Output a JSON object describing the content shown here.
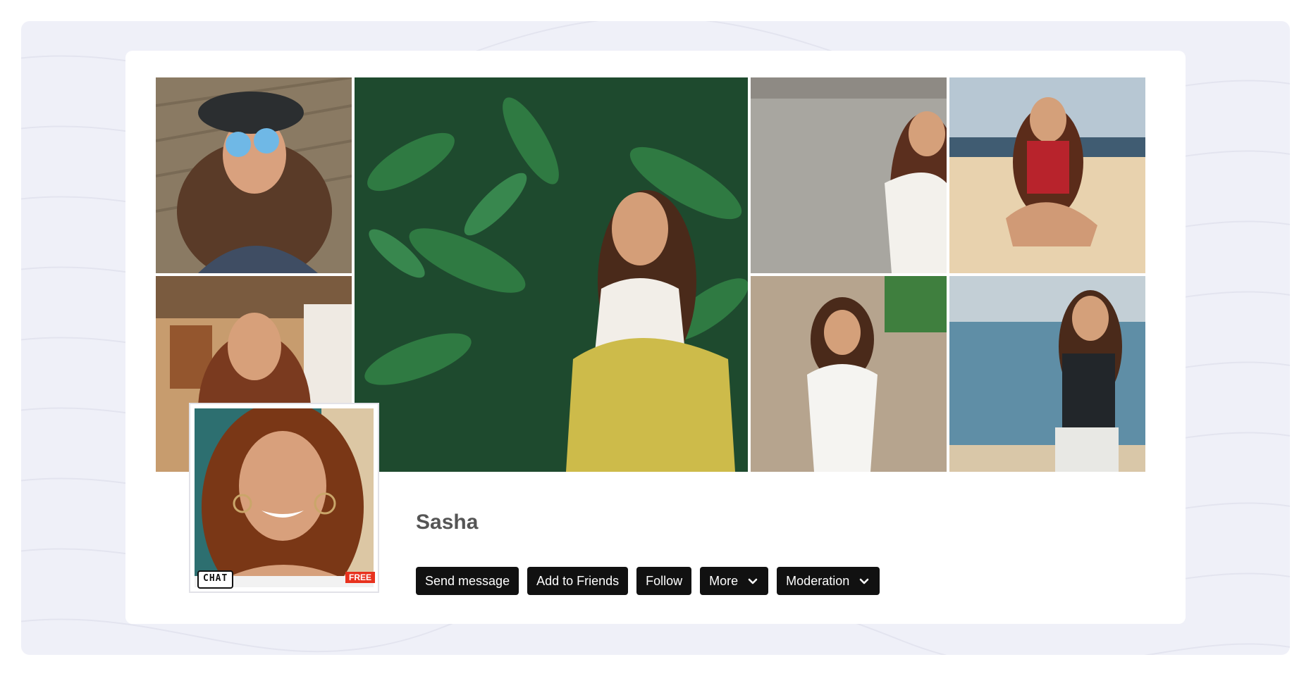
{
  "profile": {
    "name": "Sasha",
    "avatar_badges": {
      "chat": "CHAT",
      "free": "FREE"
    }
  },
  "actions": {
    "send_message": "Send message",
    "add_friends": "Add to Friends",
    "follow": "Follow",
    "more": "More",
    "moderation": "Moderation"
  },
  "icons": {
    "dropdown": "chevron-down-icon"
  },
  "colors": {
    "page_background": "#eff0f8",
    "button": "#111111",
    "free_badge": "#e8321e"
  }
}
